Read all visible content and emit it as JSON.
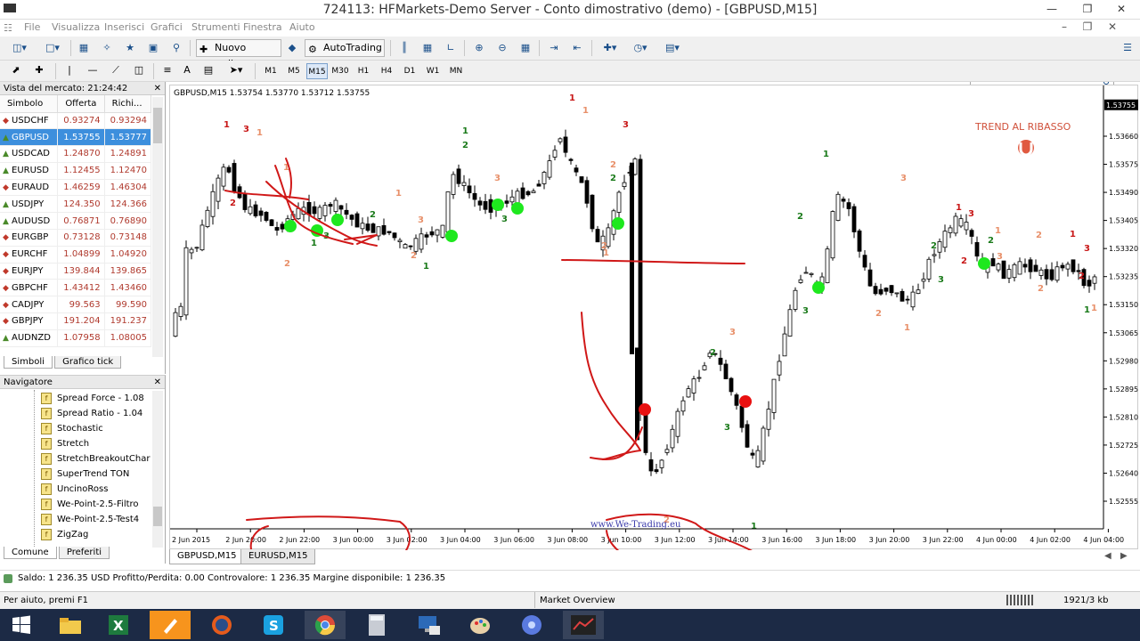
{
  "window": {
    "title": "724113: HFMarkets-Demo Server - Conto dimostrativo (demo) - [GBPUSD,M15]"
  },
  "menu": [
    "File",
    "Visualizza",
    "Inserisci",
    "Grafici",
    "Strumenti",
    "Finestra",
    "Aiuto"
  ],
  "toolbar": {
    "new_order": "Nuovo ordine",
    "autotrading": "AutoTrading",
    "timeframes": [
      "M1",
      "M5",
      "M15",
      "M30",
      "H1",
      "H4",
      "D1",
      "W1",
      "MN"
    ],
    "active_timeframe": "M15"
  },
  "market_watch": {
    "title": "Vista del mercato: 21:24:42",
    "columns": [
      "Simbolo",
      "Offerta",
      "Richi..."
    ],
    "rows": [
      {
        "symbol": "USDCHF",
        "bid": "0.93274",
        "ask": "0.93294",
        "dir": "down"
      },
      {
        "symbol": "GBPUSD",
        "bid": "1.53755",
        "ask": "1.53777",
        "dir": "up",
        "selected": true
      },
      {
        "symbol": "USDCAD",
        "bid": "1.24870",
        "ask": "1.24891",
        "dir": "up"
      },
      {
        "symbol": "EURUSD",
        "bid": "1.12455",
        "ask": "1.12470",
        "dir": "up"
      },
      {
        "symbol": "EURAUD",
        "bid": "1.46259",
        "ask": "1.46304",
        "dir": "down"
      },
      {
        "symbol": "USDJPY",
        "bid": "124.350",
        "ask": "124.366",
        "dir": "up"
      },
      {
        "symbol": "AUDUSD",
        "bid": "0.76871",
        "ask": "0.76890",
        "dir": "up"
      },
      {
        "symbol": "EURGBP",
        "bid": "0.73128",
        "ask": "0.73148",
        "dir": "down"
      },
      {
        "symbol": "EURCHF",
        "bid": "1.04899",
        "ask": "1.04920",
        "dir": "down"
      },
      {
        "symbol": "EURJPY",
        "bid": "139.844",
        "ask": "139.865",
        "dir": "down"
      },
      {
        "symbol": "GBPCHF",
        "bid": "1.43412",
        "ask": "1.43460",
        "dir": "down"
      },
      {
        "symbol": "CADJPY",
        "bid": "99.563",
        "ask": "99.590",
        "dir": "down"
      },
      {
        "symbol": "GBPJPY",
        "bid": "191.204",
        "ask": "191.237",
        "dir": "down"
      },
      {
        "symbol": "AUDNZD",
        "bid": "1.07958",
        "ask": "1.08005",
        "dir": "up"
      }
    ],
    "tabs": [
      "Simboli",
      "Grafico tick"
    ]
  },
  "navigator": {
    "title": "Navigatore",
    "items": [
      "Spread Force - 1.08",
      "Spread Ratio - 1.04",
      "Stochastic",
      "Stretch",
      "StretchBreakoutChar",
      "SuperTrend TON",
      "UncinoRoss",
      "We-Point-2.5-Filtro",
      "We-Point-2.5-Test4",
      "ZigZag"
    ],
    "tabs": [
      "Comune",
      "Preferiti"
    ]
  },
  "chart": {
    "header": "GBPUSD,M15  1.53754 1.53770 1.53712 1.53755",
    "annotation": "TREND AL RIBASSO",
    "watermark": "www.We-Trading.eu",
    "current_price": "1.53755",
    "price_labels": [
      "1.53660",
      "1.53575",
      "1.53490",
      "1.53405",
      "1.53320",
      "1.53235",
      "1.53150",
      "1.53065",
      "1.52980",
      "1.52895",
      "1.52810",
      "1.52725",
      "1.52640",
      "1.52555"
    ],
    "time_labels": [
      "2 Jun 2015",
      "2 Jun 20:00",
      "2 Jun 22:00",
      "3 Jun 00:00",
      "3 Jun 02:00",
      "3 Jun 04:00",
      "3 Jun 06:00",
      "3 Jun 08:00",
      "3 Jun 10:00",
      "3 Jun 12:00",
      "3 Jun 14:00",
      "3 Jun 16:00",
      "3 Jun 18:00",
      "3 Jun 20:00",
      "3 Jun 22:00",
      "4 Jun 00:00",
      "4 Jun 02:00",
      "4 Jun 04:00"
    ],
    "tabs": [
      "GBPUSD,M15",
      "EURUSD,M15"
    ],
    "colors": {
      "up": "#ffffff",
      "down": "#000000",
      "buy_dot": "#1ee81e",
      "sell_dot": "#e81010",
      "red_label": "#c81818",
      "green_label": "#1a7a1a",
      "grey_label": "#7a8a8a",
      "orange_label": "#e8906a",
      "ink": "#d01818"
    }
  },
  "account": {
    "status": "Saldo: 1 236.35 USD  Profitto/Perdita: 0.00  Controvalore: 1 236.35  Margine disponibile: 1 236.35"
  },
  "statusbar": {
    "help": "Per aiuto, premi F1",
    "profile": "Market Overview",
    "traffic": "1921/3 kb"
  },
  "taskbar": {
    "apps": [
      "start-icon",
      "file-explorer-icon",
      "excel-icon",
      "paint-icon",
      "firefox-icon",
      "skype-icon",
      "chrome-icon",
      "calculator-icon",
      "remote-desktop-icon",
      "paint-palette-icon",
      "snowflake-app-icon",
      "metatrader-icon"
    ]
  }
}
